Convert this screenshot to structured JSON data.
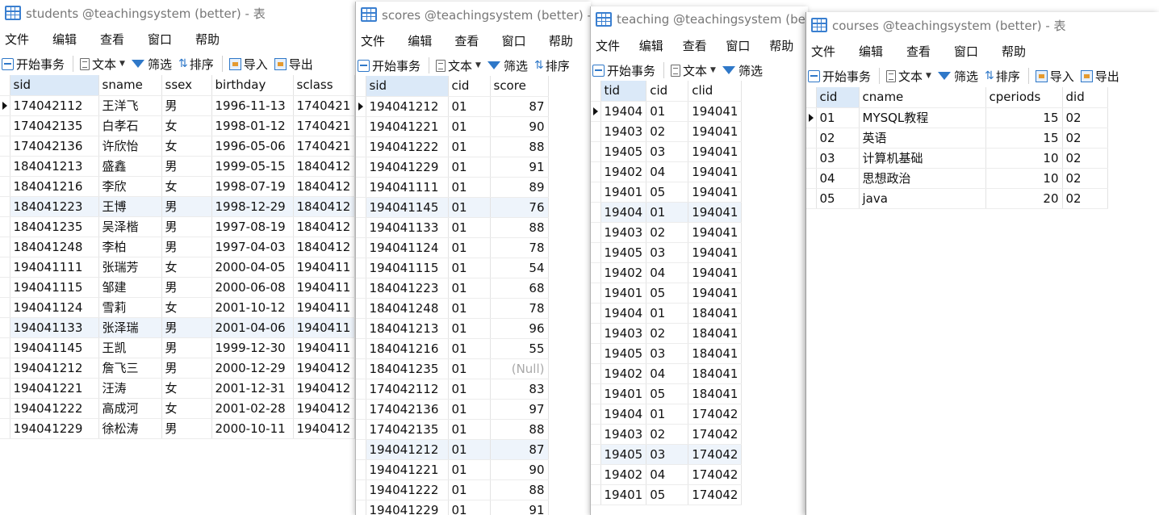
{
  "menus": [
    "文件",
    "编辑",
    "查看",
    "窗口",
    "帮助"
  ],
  "toolbar": {
    "begin_transaction": "开始事务",
    "text": "文本",
    "filter": "筛选",
    "sort": "排序",
    "import": "导入",
    "export": "导出"
  },
  "windows": {
    "students": {
      "title": "students @teachingsystem (better) - 表",
      "columns": [
        "sid",
        "sname",
        "ssex",
        "birthday",
        "sclass"
      ],
      "rows": [
        [
          "174042112",
          "王洋飞",
          "男",
          "1996-11-13",
          "1740421"
        ],
        [
          "174042135",
          "白孝石",
          "女",
          "1998-01-12",
          "1740421"
        ],
        [
          "174042136",
          "许欣怡",
          "女",
          "1996-05-06",
          "1740421"
        ],
        [
          "184041213",
          "盛鑫",
          "男",
          "1999-05-15",
          "1840412"
        ],
        [
          "184041216",
          "李欣",
          "女",
          "1998-07-19",
          "1840412"
        ],
        [
          "184041223",
          "王博",
          "男",
          "1998-12-29",
          "1840412"
        ],
        [
          "184041235",
          "吴泽楷",
          "男",
          "1997-08-19",
          "1840412"
        ],
        [
          "184041248",
          "李柏",
          "男",
          "1997-04-03",
          "1840412"
        ],
        [
          "194041111",
          "张瑞芳",
          "女",
          "2000-04-05",
          "1940411"
        ],
        [
          "194041115",
          "邹建",
          "男",
          "2000-06-08",
          "1940411"
        ],
        [
          "194041124",
          "雪莉",
          "女",
          "2001-10-12",
          "1940411"
        ],
        [
          "194041133",
          "张泽瑞",
          "男",
          "2001-04-06",
          "1940411"
        ],
        [
          "194041145",
          "王凯",
          "男",
          "1999-12-30",
          "1940411"
        ],
        [
          "194041212",
          "詹飞三",
          "男",
          "2000-12-29",
          "1940412"
        ],
        [
          "194041221",
          "汪涛",
          "女",
          "2001-12-31",
          "1940412"
        ],
        [
          "194041222",
          "高成河",
          "女",
          "2001-02-28",
          "1940412"
        ],
        [
          "194041229",
          "徐松涛",
          "男",
          "2000-10-11",
          "1940412"
        ]
      ]
    },
    "scores": {
      "title": "scores @teachingsystem (better) - 表",
      "columns": [
        "sid",
        "cid",
        "score"
      ],
      "rows": [
        [
          "194041212",
          "01",
          "87"
        ],
        [
          "194041221",
          "01",
          "90"
        ],
        [
          "194041222",
          "01",
          "88"
        ],
        [
          "194041229",
          "01",
          "91"
        ],
        [
          "194041111",
          "01",
          "89"
        ],
        [
          "194041145",
          "01",
          "76"
        ],
        [
          "194041133",
          "01",
          "88"
        ],
        [
          "194041124",
          "01",
          "78"
        ],
        [
          "194041115",
          "01",
          "54"
        ],
        [
          "184041223",
          "01",
          "68"
        ],
        [
          "184041248",
          "01",
          "78"
        ],
        [
          "184041213",
          "01",
          "96"
        ],
        [
          "184041216",
          "01",
          "55"
        ],
        [
          "184041235",
          "01",
          "(Null)"
        ],
        [
          "174042112",
          "01",
          "83"
        ],
        [
          "174042136",
          "01",
          "97"
        ],
        [
          "174042135",
          "01",
          "88"
        ],
        [
          "194041212",
          "01",
          "87"
        ],
        [
          "194041221",
          "01",
          "90"
        ],
        [
          "194041222",
          "01",
          "88"
        ],
        [
          "194041229",
          "01",
          "91"
        ]
      ]
    },
    "teaching": {
      "title": "teaching @teachingsystem (bette",
      "columns": [
        "tid",
        "cid",
        "clid"
      ],
      "rows": [
        [
          "19404",
          "01",
          "194041"
        ],
        [
          "19403",
          "02",
          "194041"
        ],
        [
          "19405",
          "03",
          "194041"
        ],
        [
          "19402",
          "04",
          "194041"
        ],
        [
          "19401",
          "05",
          "194041"
        ],
        [
          "19404",
          "01",
          "194041"
        ],
        [
          "19403",
          "02",
          "194041"
        ],
        [
          "19405",
          "03",
          "194041"
        ],
        [
          "19402",
          "04",
          "194041"
        ],
        [
          "19401",
          "05",
          "194041"
        ],
        [
          "19404",
          "01",
          "184041"
        ],
        [
          "19403",
          "02",
          "184041"
        ],
        [
          "19405",
          "03",
          "184041"
        ],
        [
          "19402",
          "04",
          "184041"
        ],
        [
          "19401",
          "05",
          "184041"
        ],
        [
          "19404",
          "01",
          "174042"
        ],
        [
          "19403",
          "02",
          "174042"
        ],
        [
          "19405",
          "03",
          "174042"
        ],
        [
          "19402",
          "04",
          "174042"
        ],
        [
          "19401",
          "05",
          "174042"
        ]
      ]
    },
    "courses": {
      "title": "courses @teachingsystem (better) - 表",
      "columns": [
        "cid",
        "cname",
        "cperiods",
        "did"
      ],
      "rows": [
        [
          "01",
          "MYSQL教程",
          "15",
          "02"
        ],
        [
          "02",
          "英语",
          "15",
          "02"
        ],
        [
          "03",
          "计算机基础",
          "10",
          "02"
        ],
        [
          "04",
          "思想政治",
          "10",
          "02"
        ],
        [
          "05",
          "java",
          "20",
          "02"
        ]
      ]
    }
  }
}
